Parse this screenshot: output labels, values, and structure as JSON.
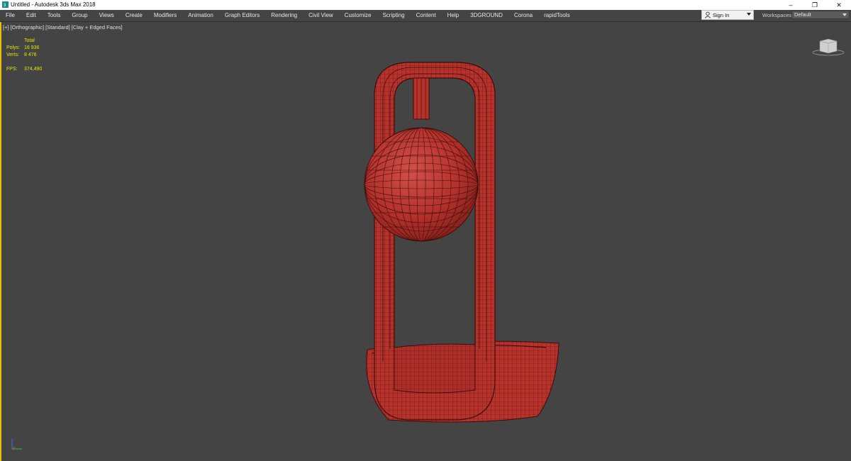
{
  "window": {
    "title": "Untitled - Autodesk 3ds Max 2018",
    "controls": {
      "minimize": "–",
      "restore": "❐",
      "close": "✕"
    }
  },
  "menu": [
    "File",
    "Edit",
    "Tools",
    "Group",
    "Views",
    "Create",
    "Modifiers",
    "Animation",
    "Graph Editors",
    "Rendering",
    "Civil View",
    "Customize",
    "Scripting",
    "Content",
    "Help",
    "3DGROUND",
    "Corona",
    "rapidTools"
  ],
  "signin": {
    "label": "Sign In"
  },
  "workspaces": {
    "label": "Workspaces:",
    "value": "Default"
  },
  "viewport": {
    "labels": [
      "[+]",
      "[Orthographic]",
      "[Standard]",
      "[Clay + Edged Faces]"
    ],
    "stats": {
      "total_label": "Total",
      "polys_label": "Polys:",
      "polys": "16 936",
      "verts_label": "Verts:",
      "verts": "8 476",
      "fps_label": "FPS:",
      "fps": "374,490"
    }
  },
  "colors": {
    "viewport_bg": "#444444",
    "active_border": "#e8c200",
    "stats_text": "#e6e600",
    "model": "#b8322c",
    "wire": "#3a0d0b"
  },
  "icons": {
    "app": "3dsmax-icon",
    "user": "user-icon",
    "viewcube": "viewcube-icon",
    "axis": "axis-gizmo-icon"
  }
}
